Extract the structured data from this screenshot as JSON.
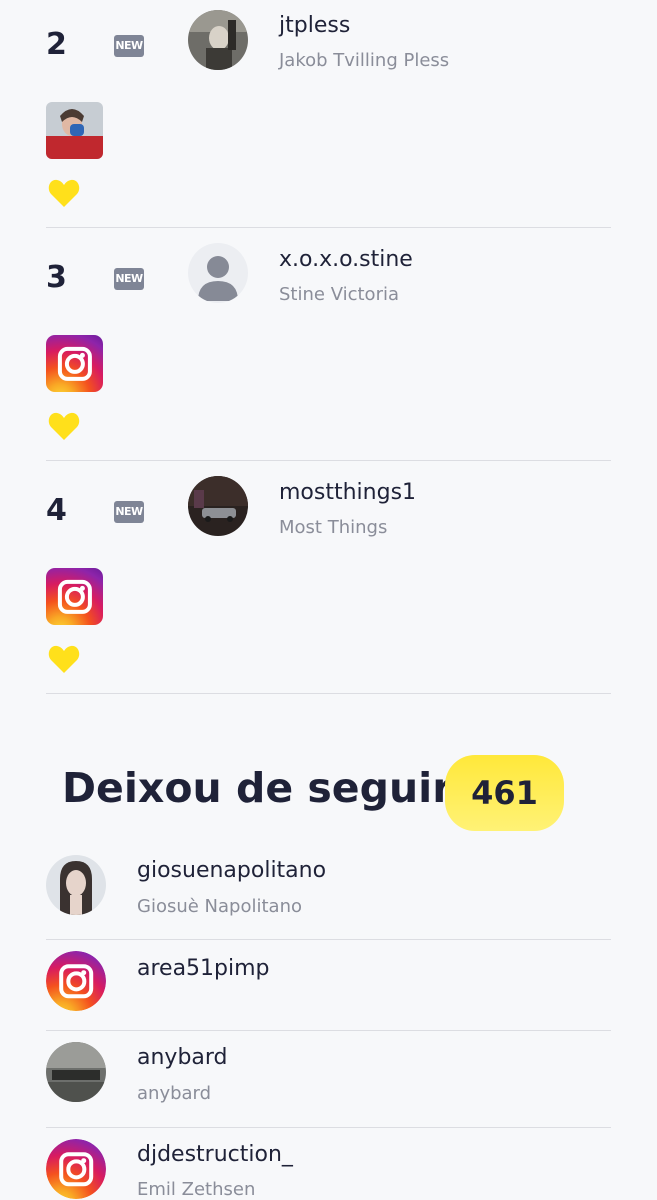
{
  "new_followers": [
    {
      "rank": "2",
      "badge": "NEW",
      "username": "jtpless",
      "full_name": "Jakob Tvilling Pless",
      "avatar": "photo-avatar",
      "post_icon": "photo-thumbnail",
      "liked": true
    },
    {
      "rank": "3",
      "badge": "NEW",
      "username": "x.o.x.o.stine",
      "full_name": "Stine Victoria",
      "avatar": "default-user-avatar",
      "post_icon": "instagram-icon",
      "liked": true
    },
    {
      "rank": "4",
      "badge": "NEW",
      "username": "mostthings1",
      "full_name": "Most Things",
      "avatar": "photo-avatar",
      "post_icon": "instagram-icon",
      "liked": true
    }
  ],
  "unfollowed_section": {
    "title": "Deixou de seguir",
    "count": "461"
  },
  "unfollowed": [
    {
      "username": "giosuenapolitano",
      "full_name": "Giosuè Napolitano",
      "avatar": "photo-avatar"
    },
    {
      "username": "area51pimp",
      "full_name": "",
      "avatar": "instagram-icon"
    },
    {
      "username": "anybard",
      "full_name": "anybard",
      "avatar": "photo-avatar"
    },
    {
      "username": "djdestruction_",
      "full_name": "Emil Zethsen",
      "avatar": "instagram-icon"
    }
  ],
  "colors": {
    "background": "#f7f8fa",
    "heart": "#ffe01b",
    "count_pill": "#ffe83a",
    "badge": "#7f8596",
    "primary_text": "#1f2238",
    "secondary_text": "#8a8d99"
  }
}
